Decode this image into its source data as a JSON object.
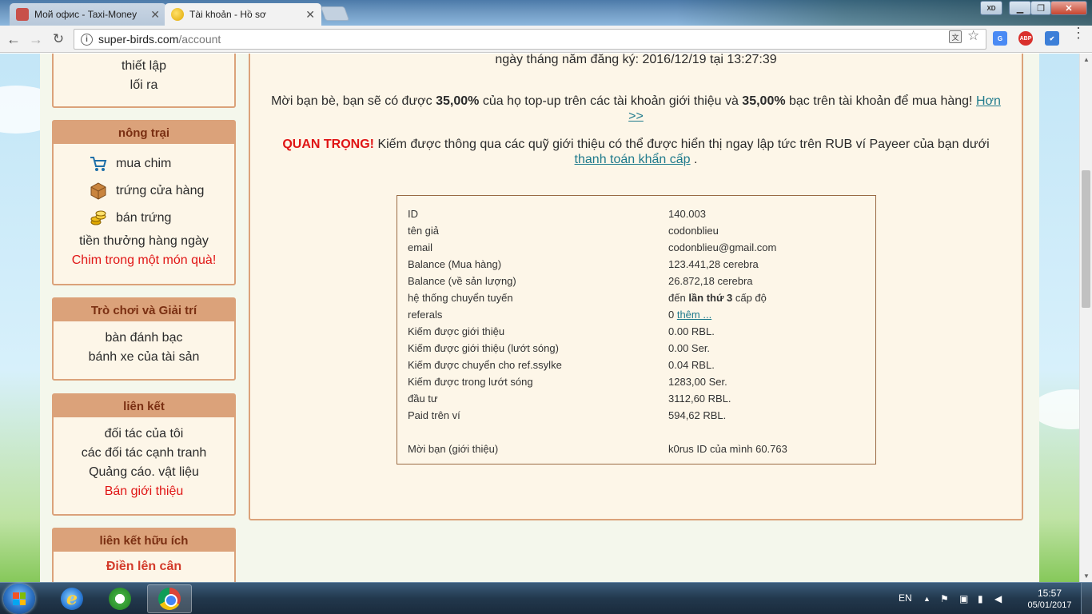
{
  "browser": {
    "tabs": [
      {
        "label": "Мой офис - Taxi-Money",
        "active": false
      },
      {
        "label": "Tài khoản - Hồ sơ",
        "active": true
      }
    ],
    "url_host": "super-birds.com",
    "url_path": "/account",
    "user_badge": "XD"
  },
  "sidebar": {
    "settings": {
      "items": [
        "thiết lập",
        "lối ra"
      ]
    },
    "farm": {
      "title": "nông trại",
      "items": [
        "mua chim",
        "trứng cửa hàng",
        "bán trứng"
      ],
      "daily_bonus": "tiền thưởng hàng ngày",
      "gift": "Chim trong một món quà!"
    },
    "games": {
      "title": "Trò chơi và Giải trí",
      "items": [
        "bàn đánh bạc",
        "bánh xe của tài sản"
      ]
    },
    "links": {
      "title": "liên kết",
      "items": [
        "đối tác của tôi",
        "các đối tác cạnh tranh",
        "Quảng cáo. vật liệu"
      ],
      "sell": "Bán giới thiệu"
    },
    "useful": {
      "title": "liên kết hữu ích",
      "item": "Điền lên cân"
    }
  },
  "main": {
    "reg_date": "ngày tháng năm đăng ký: 2016/12/19 tại 13:27:39",
    "invite": {
      "prefix": "Mời bạn bè, bạn sẽ có được ",
      "pct1": "35,00%",
      "mid": " của họ top-up trên các tài khoản giới thiệu và ",
      "pct2": "35,00%",
      "suffix": " bạc trên tài khoản để mua hàng! ",
      "more": "Hơn >>"
    },
    "important": {
      "label": "QUAN TRỌNG!",
      "text": " Kiếm được thông qua các quỹ giới thiệu có thể được hiển thị ngay lập tức trên RUB ví Payeer của bạn dưới ",
      "link": "thanh toán khẩn cấp",
      "end": " ."
    },
    "table": [
      {
        "k": "ID",
        "v": "140.003"
      },
      {
        "k": "tên giả",
        "v": "codonblieu"
      },
      {
        "k": "email",
        "v": "codonblieu@gmail.com"
      },
      {
        "k": "Balance (Mua hàng)",
        "v": "123.441,28 cerebra"
      },
      {
        "k": "Balance (về sản lượng)",
        "v": "26.872,18 cerebra"
      },
      {
        "k": "hệ thống chuyển tuyến",
        "v_pre": "đến ",
        "v_bold": "lần thứ 3",
        "v_post": " cấp độ"
      },
      {
        "k": "referals",
        "v_pre": "0 ",
        "v_link": "thêm ..."
      },
      {
        "k": "Kiếm được giới thiệu",
        "v": "0.00 RBL."
      },
      {
        "k": "Kiếm được giới thiệu (lướt sóng)",
        "v": "0.00 Ser."
      },
      {
        "k": "Kiếm được chuyển cho ref.ssylke",
        "v": "0.04 RBL."
      },
      {
        "k": "Kiếm được trong lướt sóng",
        "v": "1283,00 Ser."
      },
      {
        "k": "đầu tư",
        "v": "3112,60 RBL."
      },
      {
        "k": "Paid trên ví",
        "v": "594,62 RBL."
      },
      {
        "k": "Mời bạn (giới thiệu)",
        "v": "k0rus ID của mình 60.763"
      }
    ]
  },
  "taskbar": {
    "lang": "EN",
    "time": "15:57",
    "date": "05/01/2017"
  },
  "colors": {
    "accent_brown": "#dba27a",
    "heading_text": "#7a2f12",
    "warning_red": "#e01515",
    "link_teal": "#1f7a8c"
  }
}
